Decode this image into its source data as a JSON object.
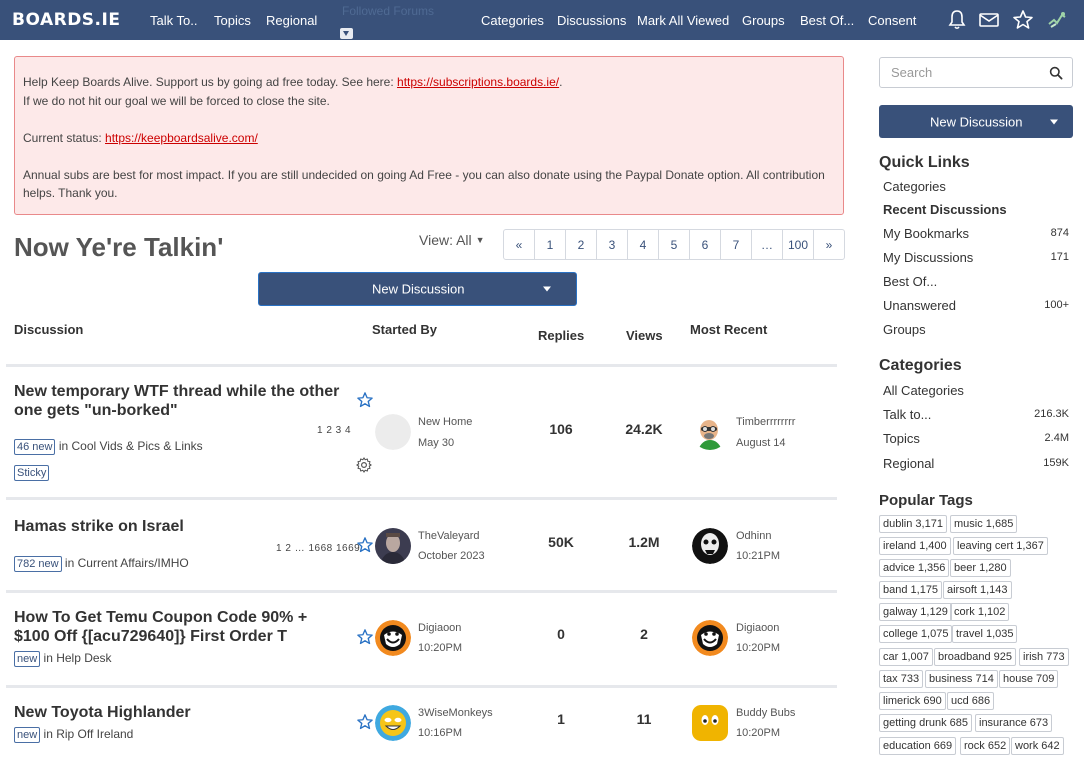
{
  "topnav": {
    "logo": "BOARDS.IE",
    "links": [
      "Talk To..",
      "Topics",
      "Regional"
    ],
    "followed_label": "Followed Forums",
    "right_links": [
      "Categories",
      "Discussions",
      "Mark All Viewed",
      "Groups",
      "Best Of...",
      "Consent"
    ],
    "icons": [
      "bell-icon",
      "mail-icon",
      "star-icon",
      "profile-icon"
    ],
    "bg_color": "#39517a"
  },
  "alert": {
    "line1_text": "Help Keep Boards Alive. Support us by going ad free today. See here: ",
    "line1_link": "https://subscriptions.boards.ie/",
    "line1_end": ".",
    "line2": "If we do not hit our goal we will be forced to close the site.",
    "status_label": "Current status: ",
    "status_link": "https://keepboardsalive.com/",
    "para3": "Annual subs are best for most impact. If you are still undecided on going Ad Free - you can also donate using the Paypal Donate option. All contribution helps. Thank you."
  },
  "page": {
    "title": "Now Ye're Talkin'",
    "view_label": "View: All",
    "pager": [
      "«",
      "1",
      "2",
      "3",
      "4",
      "5",
      "6",
      "7",
      "…",
      "100",
      "»"
    ],
    "new_discussion_label": "New Discussion"
  },
  "table": {
    "headers": {
      "discussion": "Discussion",
      "started_by": "Started By",
      "replies": "Replies",
      "views": "Views",
      "most_recent": "Most Recent"
    },
    "rows": [
      {
        "title": "New temporary WTF thread while the other one gets \"un-borked\"",
        "new_badge": "46 new",
        "category_prefix": " in ",
        "category": "Cool Vids & Pics & Links",
        "sticky": "Sticky",
        "pages": "1 2 3 4",
        "starter": "New Home",
        "started": "May 30",
        "replies": "106",
        "views": "24.2K",
        "recent_user": "Timberrrrrrrr",
        "recent_time": "August 14"
      },
      {
        "title": "Hamas strike on Israel",
        "new_badge": "782 new",
        "category_prefix": " in ",
        "category": "Current Affairs/IMHO",
        "pages": "1 2 … 1668 1669",
        "starter": "TheValeyard",
        "started": "October 2023",
        "replies": "50K",
        "views": "1.2M",
        "recent_user": "Odhinn",
        "recent_time": "10:21PM"
      },
      {
        "title": "How To Get Temu Coupon Code 90% + $100 Off {[acu729640]} First Order T",
        "new_badge": "new",
        "category_prefix": " in ",
        "category": "Help Desk",
        "starter": "Digiaoon",
        "started": "10:20PM",
        "replies": "0",
        "views": "2",
        "recent_user": "Digiaoon",
        "recent_time": "10:20PM"
      },
      {
        "title": "New Toyota Highlander",
        "new_badge": "new",
        "category_prefix": " in ",
        "category": "Rip Off Ireland",
        "starter": "3WiseMonkeys",
        "started": "10:16PM",
        "replies": "1",
        "views": "11",
        "recent_user": "Buddy Bubs",
        "recent_time": "10:20PM"
      }
    ]
  },
  "sidebar": {
    "search_placeholder": "Search",
    "new_discussion_label": "New Discussion",
    "quick_links_title": "Quick Links",
    "quick_links": [
      {
        "label": "Categories",
        "count": ""
      },
      {
        "label": "Recent Discussions",
        "count": ""
      },
      {
        "label": "My Bookmarks",
        "count": "874"
      },
      {
        "label": "My Discussions",
        "count": "171"
      },
      {
        "label": "Best Of...",
        "count": ""
      },
      {
        "label": "Unanswered",
        "count": "100+"
      },
      {
        "label": "Groups",
        "count": ""
      }
    ],
    "categories_title": "Categories",
    "categories": [
      {
        "label": "All Categories",
        "count": ""
      },
      {
        "label": "Talk to...",
        "count": "216.3K"
      },
      {
        "label": "Topics",
        "count": "2.4M"
      },
      {
        "label": "Regional",
        "count": "159K"
      }
    ],
    "tags_title": "Popular Tags",
    "tags": [
      "dublin 3,171",
      "music 1,685",
      "ireland 1,400",
      "leaving cert 1,367",
      "advice 1,356",
      "beer 1,280",
      "band 1,175",
      "airsoft 1,143",
      "galway 1,129",
      "cork 1,102",
      "college 1,075",
      "travel 1,035",
      "car 1,007",
      "broadband 925",
      "irish 773",
      "tax 733",
      "business 714",
      "house 709",
      "limerick 690",
      "ucd 686",
      "getting drunk 685",
      "insurance 673",
      "education 669",
      "rock 652",
      "work 642"
    ]
  }
}
